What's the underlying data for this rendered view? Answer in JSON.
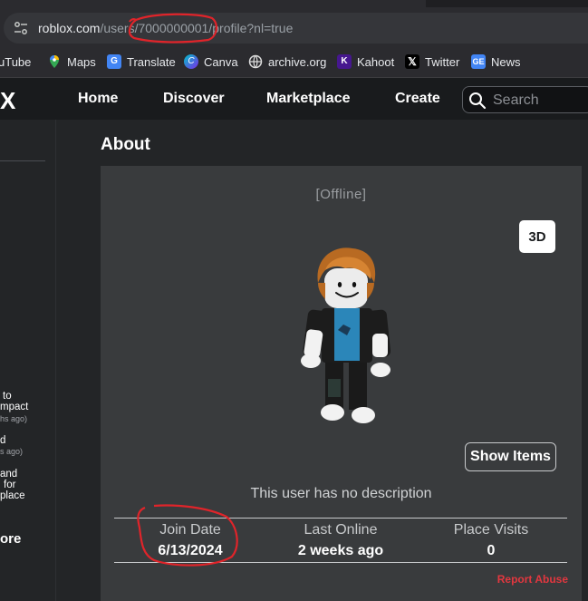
{
  "browser": {
    "url_host": "roblox.com",
    "url_path_a": "/users/",
    "url_user_id": "7000000001",
    "url_path_b": "/profile?nl=true"
  },
  "bookmarks": [
    {
      "label": "uTube",
      "icon": "youtube-icon",
      "color": "#ff0000"
    },
    {
      "label": "Maps",
      "icon": "maps-icon",
      "color": "#34a853"
    },
    {
      "label": "Translate",
      "icon": "translate-icon",
      "color": "#4285f4"
    },
    {
      "label": "Canva",
      "icon": "canva-icon",
      "color": "#7d2ae8"
    },
    {
      "label": "archive.org",
      "icon": "archive-icon",
      "color": "#dddddd"
    },
    {
      "label": "Kahoot",
      "icon": "kahoot-icon",
      "color": "#46178f"
    },
    {
      "label": "Twitter",
      "icon": "x-icon",
      "color": "#000000"
    },
    {
      "label": "News",
      "icon": "google-news-icon",
      "color": "#4285f4"
    }
  ],
  "nav": {
    "logo": "X",
    "links": [
      "Home",
      "Discover",
      "Marketplace",
      "Create"
    ],
    "search_placeholder": "Search"
  },
  "sidebar": {
    "feed_lines": [
      "to",
      "mpact",
      "hs ago)",
      "d",
      "s ago)",
      "and",
      "for",
      "place"
    ],
    "more_label": "ore"
  },
  "about": {
    "title": "About",
    "status": "[Offline]",
    "btn_3d": "3D",
    "show_items": "Show Items",
    "description": "This user has no description",
    "stats": [
      {
        "label": "Join Date",
        "value": "6/13/2024"
      },
      {
        "label": "Last Online",
        "value": "2 weeks ago"
      },
      {
        "label": "Place Visits",
        "value": "0"
      }
    ],
    "report": "Report Abuse"
  },
  "colors": {
    "accent_report": "#e2373f",
    "annotation_red": "#e0242a"
  }
}
